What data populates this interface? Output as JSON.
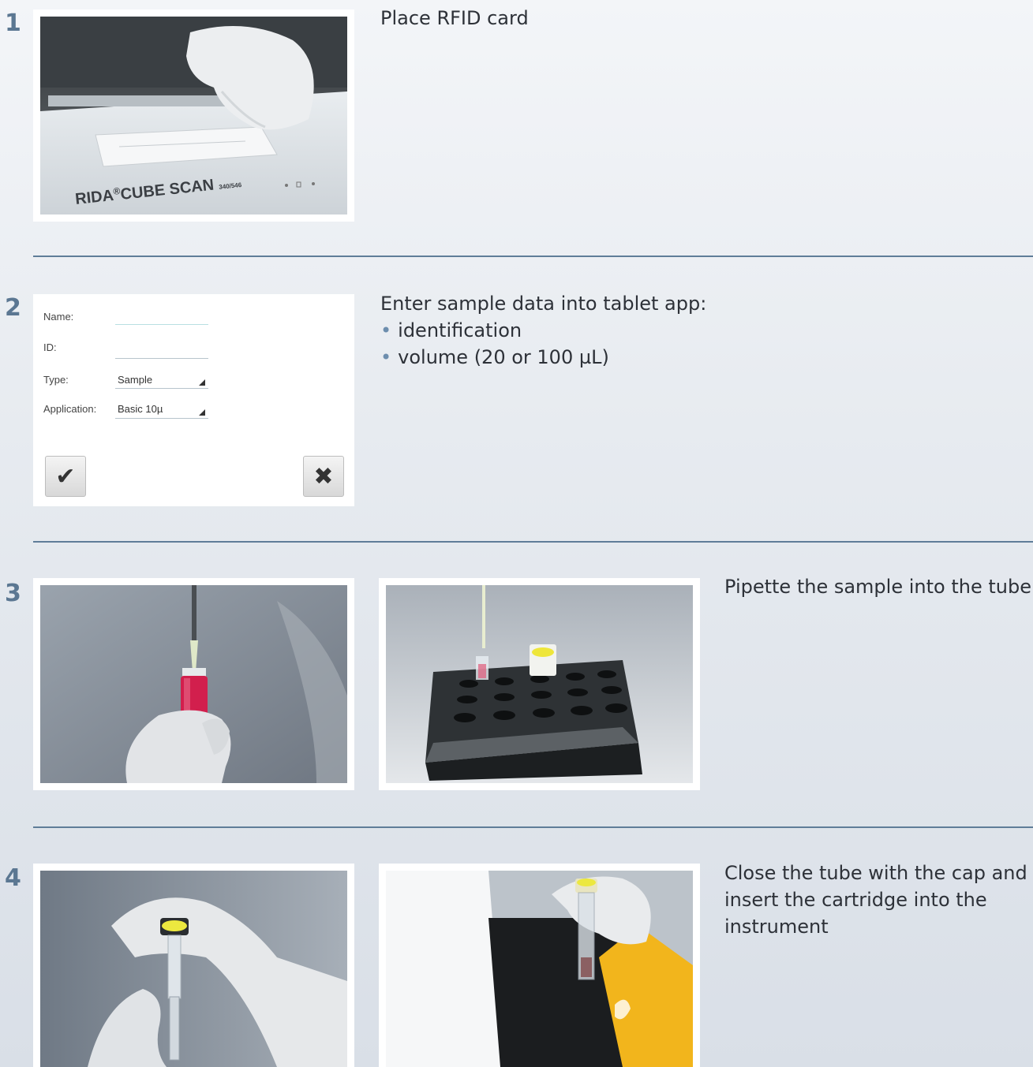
{
  "steps": [
    {
      "number": "1",
      "text": "Place RFID card"
    },
    {
      "number": "2",
      "title": "Enter sample data into tablet app:",
      "bullets": [
        "identification",
        "volume (20 or 100 µL)"
      ]
    },
    {
      "number": "3",
      "text": "Pipette the sample into the tube"
    },
    {
      "number": "4",
      "lines": [
        "Close the tube with the cap and",
        "insert the cartridge into the",
        "instrument"
      ]
    }
  ],
  "device_label": {
    "brand": "RIDA",
    "reg": "®",
    "model": "CUBE SCAN",
    "version": "340/546"
  },
  "app_form": {
    "name_label": "Name:",
    "id_label": "ID:",
    "type_label": "Type:",
    "type_value": "Sample",
    "application_label": "Application:",
    "application_value": "Basic 10µ",
    "confirm_icon": "✔",
    "cancel_icon": "✖"
  },
  "colors": {
    "accent": "#5b7792",
    "divider": "#5f7d98",
    "bullet": "#6d8eae",
    "cartridge_yellow": "#f2b51c"
  }
}
